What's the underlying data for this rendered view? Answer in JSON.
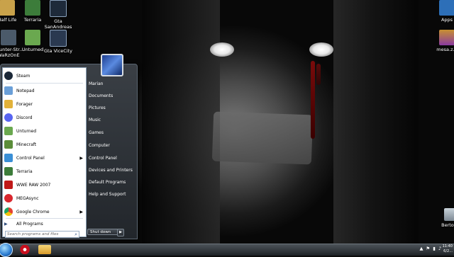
{
  "desktop": {
    "icons": [
      {
        "label": "Half Life",
        "color": "#c9a24a"
      },
      {
        "label": "Terraria",
        "color": "#3c7c3a"
      },
      {
        "label": "Gta SanAndreas",
        "color": "#1e2a3a"
      },
      {
        "label": "Counter-Str... WaRzOnE",
        "color": "#4b5a6a"
      },
      {
        "label": "Unturned",
        "color": "#6aa84f"
      },
      {
        "label": "Gta ViceCity",
        "color": "#2a3950"
      },
      {
        "label": "Apps",
        "color": "#2d6fb8"
      },
      {
        "label": "mesa.z...",
        "color": "#c89030"
      },
      {
        "label": "Berto...",
        "color": "#9aa6b0"
      }
    ]
  },
  "start_menu": {
    "user_name": "Marian",
    "programs": [
      {
        "label": "Steam",
        "icon": "steam-icon",
        "color": "#1b2838",
        "has_arrow": false
      },
      {
        "label": "Notepad",
        "icon": "notepad-icon",
        "color": "#6a9fd8",
        "has_arrow": false
      },
      {
        "label": "Forager",
        "icon": "forager-icon",
        "color": "#e2b23a",
        "has_arrow": false
      },
      {
        "label": "Discord",
        "icon": "discord-icon",
        "color": "#5865f2",
        "has_arrow": false
      },
      {
        "label": "Unturned",
        "icon": "unturned-icon",
        "color": "#6aa84f",
        "has_arrow": false
      },
      {
        "label": "Minecraft",
        "icon": "minecraft-icon",
        "color": "#5b8d3a",
        "has_arrow": false
      },
      {
        "label": "Control Panel",
        "icon": "control-panel-icon",
        "color": "#3a8fd6",
        "has_arrow": true
      },
      {
        "label": "Terraria",
        "icon": "terraria-icon",
        "color": "#3c7c3a",
        "has_arrow": false
      },
      {
        "label": "WWE RAW 2007",
        "icon": "wwe-icon",
        "color": "#c01818",
        "has_arrow": false
      },
      {
        "label": "MEGAsync",
        "icon": "megasync-icon",
        "color": "#d9272e",
        "has_arrow": false
      },
      {
        "label": "Google Chrome",
        "icon": "chrome-icon",
        "color": "#e34133",
        "has_arrow": true
      }
    ],
    "all_programs": "All Programs",
    "search_placeholder": "Search programs and files",
    "right_items": [
      "Marian",
      "Documents",
      "Pictures",
      "Music",
      "Games",
      "Computer",
      "Control Panel",
      "Devices and Printers",
      "Default Programs",
      "Help and Support"
    ],
    "shutdown_label": "Shut down"
  },
  "taskbar": {
    "pinned": [
      {
        "name": "opera",
        "color": "#c8101e"
      },
      {
        "name": "explorer",
        "color": "#e9c46a"
      }
    ],
    "clock_time": "11:40",
    "clock_date": "6/2..."
  }
}
